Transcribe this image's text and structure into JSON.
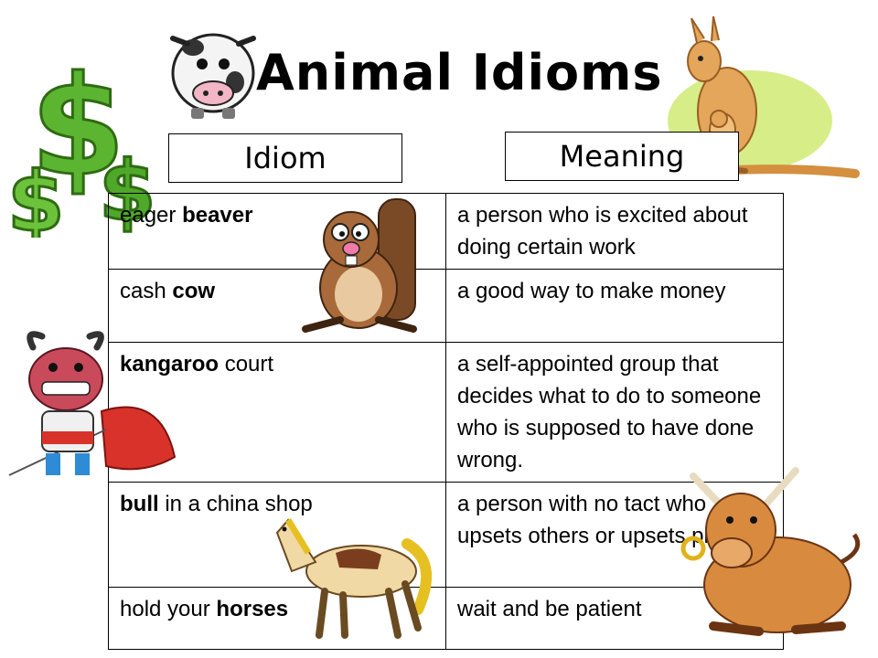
{
  "title": "Animal Idioms",
  "headers": {
    "idiom": "Idiom",
    "meaning": "Meaning"
  },
  "rows": [
    {
      "idiom_pre": "eager ",
      "idiom_bold": "beaver",
      "idiom_post": "",
      "meaning": "a person who is excited about doing certain work"
    },
    {
      "idiom_pre": "cash ",
      "idiom_bold": "cow",
      "idiom_post": "",
      "meaning": "a good way to make money"
    },
    {
      "idiom_pre": "",
      "idiom_bold": "kangaroo",
      "idiom_post": " court",
      "meaning": "a self-appointed group that decides what to do to someone who is supposed to have done wrong."
    },
    {
      "idiom_pre": "",
      "idiom_bold": "bull",
      "idiom_post": " in a china shop",
      "meaning": "a person with no tact who upsets others or upsets plans"
    },
    {
      "idiom_pre": "hold your ",
      "idiom_bold": "horses",
      "idiom_post": "",
      "meaning": "wait and be patient"
    }
  ],
  "illustrations": [
    "dollar-signs-icon",
    "cow-icon",
    "kangaroo-icon",
    "beaver-icon",
    "bull-matador-icon",
    "horse-icon",
    "bull-icon"
  ],
  "colors": {
    "dollar_green": "#5cb531",
    "kangaroo_tan": "#e3a65a",
    "beaver_brown": "#a86a3a",
    "bull_red": "#d9322a",
    "horse_cream": "#f0d9a4"
  }
}
